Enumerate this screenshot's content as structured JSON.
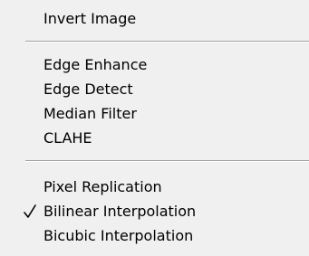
{
  "menu": {
    "items": [
      {
        "label": "Invert Image",
        "checked": false
      },
      {
        "label": "Edge Enhance",
        "checked": false
      },
      {
        "label": "Edge Detect",
        "checked": false
      },
      {
        "label": "Median Filter",
        "checked": false
      },
      {
        "label": "CLAHE",
        "checked": false
      },
      {
        "label": "Pixel Replication",
        "checked": false
      },
      {
        "label": "Bilinear Interpolation",
        "checked": true
      },
      {
        "label": "Bicubic Interpolation",
        "checked": false
      }
    ]
  }
}
